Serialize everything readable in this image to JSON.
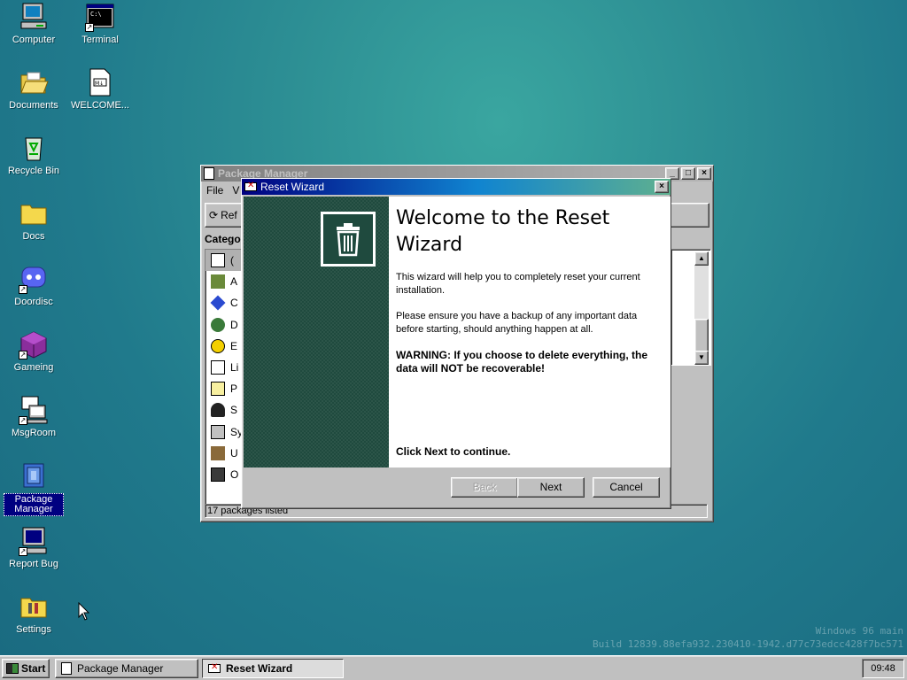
{
  "desktop": {
    "icons": [
      {
        "label": "Computer"
      },
      {
        "label": "Terminal"
      },
      {
        "label": "Documents"
      },
      {
        "label": "WELCOME..."
      },
      {
        "label": "Recycle Bin"
      },
      {
        "label": "Docs"
      },
      {
        "label": "Doordisc"
      },
      {
        "label": "Gameing"
      },
      {
        "label": "MsgRoom"
      },
      {
        "label": "Package Manager"
      },
      {
        "label": "Report Bug"
      },
      {
        "label": "Settings"
      }
    ]
  },
  "package_manager": {
    "title": "Package Manager",
    "menu": [
      "File",
      "V"
    ],
    "toolbar_refresh": "Ref",
    "categories_header": "Catego",
    "categories": [
      "(",
      "A",
      "C",
      "D",
      "E",
      "Li",
      "P",
      "S",
      "Sy",
      "U",
      "O"
    ],
    "status": "17 packages listed"
  },
  "wizard": {
    "title": "Reset Wizard",
    "heading": "Welcome to the Reset Wizard",
    "para1": "This wizard will help you to completely reset your current installation.",
    "para2": "Please ensure you have a backup of any important data before starting, should anything happen at all.",
    "warning": "WARNING: If you choose to delete everything, the data will NOT be recoverable!",
    "cta": "Click Next to continue.",
    "buttons": {
      "back": "Back",
      "next": "Next",
      "cancel": "Cancel"
    }
  },
  "watermark": {
    "line1": "Windows 96 main",
    "line2": "Build 12839.88efa932.230410-1942.d77c73edcc428f7bc571"
  },
  "taskbar": {
    "start": "Start",
    "tasks": [
      "Package Manager",
      "Reset Wizard"
    ],
    "clock": "09:48"
  },
  "colors": {
    "accent": "#000080",
    "desktop": "#207a8c",
    "wizard_side": "#1f4a3e"
  }
}
